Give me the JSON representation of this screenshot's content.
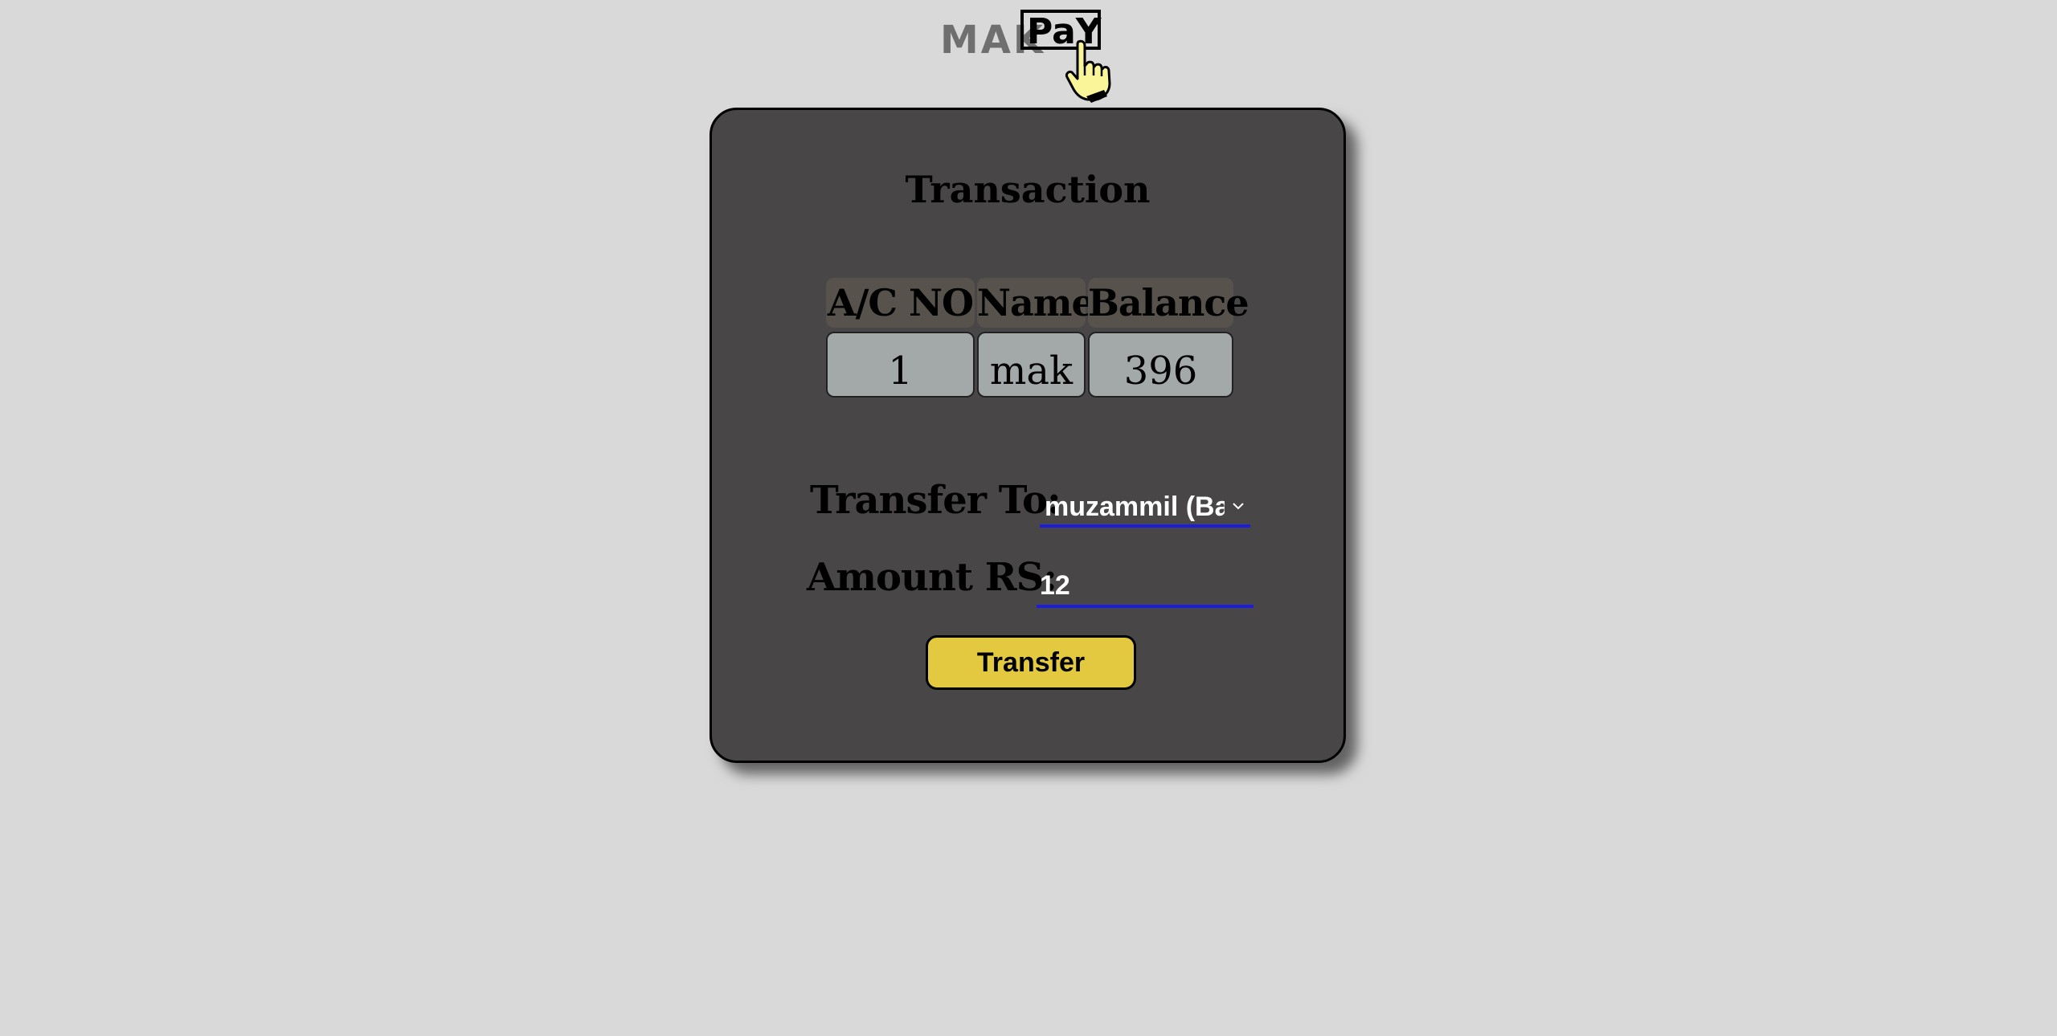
{
  "logo": {
    "text_left": "MAK",
    "text_right": "PaY",
    "icon": "pointing-hand-icon"
  },
  "card": {
    "title": "Transaction",
    "account": {
      "headers": [
        "A/C NO",
        "Name",
        "Balance"
      ],
      "row": [
        "1",
        "mak",
        "396"
      ]
    },
    "form": {
      "transfer_to_label": "Transfer To:",
      "transfer_to_value": "muzammil (Ba",
      "amount_label": "Amount RS:",
      "amount_value": "12",
      "submit_label": "Transfer"
    }
  },
  "colors": {
    "page_bg": "#d9d9d9",
    "card_bg": "#484647",
    "header_cell_bg": "#58524d",
    "data_cell_bg": "#a3a8a8",
    "input_underline": "#1c1ce0",
    "button_bg": "#e3c940"
  }
}
